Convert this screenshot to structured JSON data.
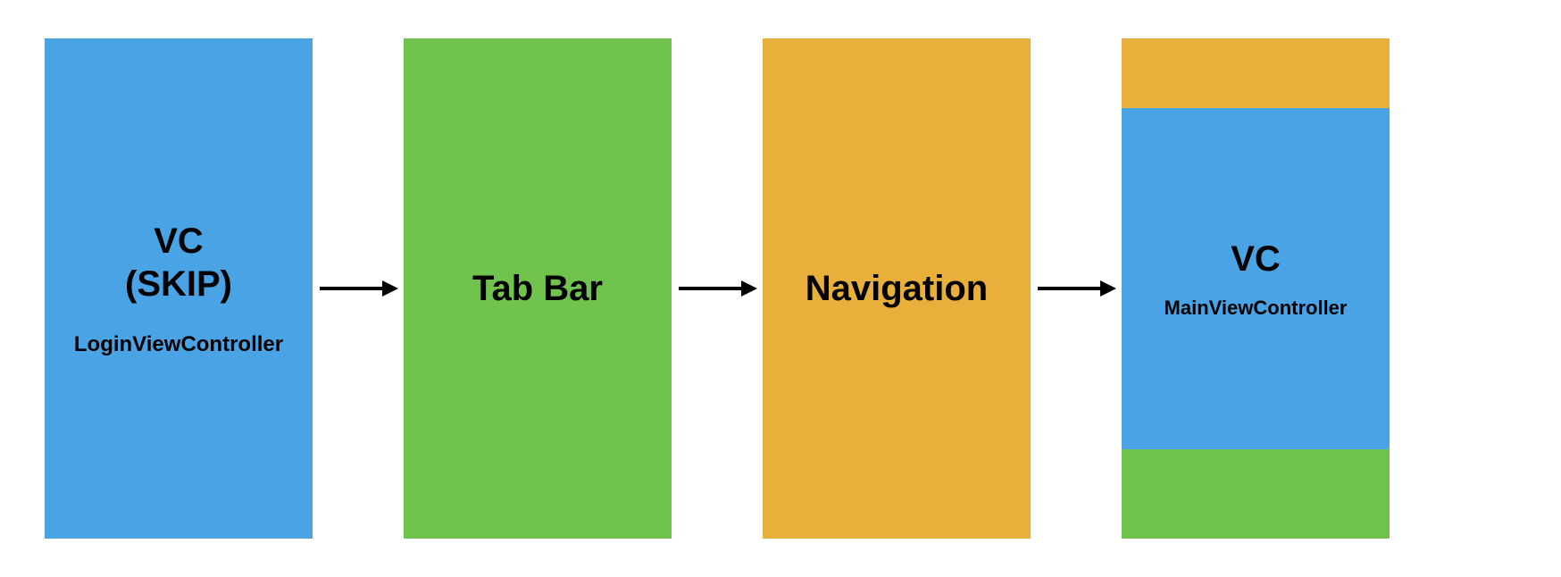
{
  "boxes": {
    "box1": {
      "title_line1": "VC",
      "title_line2": "(SKIP)",
      "subtitle": "LoginViewController"
    },
    "box2": {
      "title": "Tab Bar"
    },
    "box3": {
      "title": "Navigation"
    },
    "box4": {
      "title": "VC",
      "subtitle": "MainViewController"
    }
  },
  "colors": {
    "blue": "#4aa3e5",
    "green": "#70c44e",
    "orange": "#e8b03a"
  }
}
